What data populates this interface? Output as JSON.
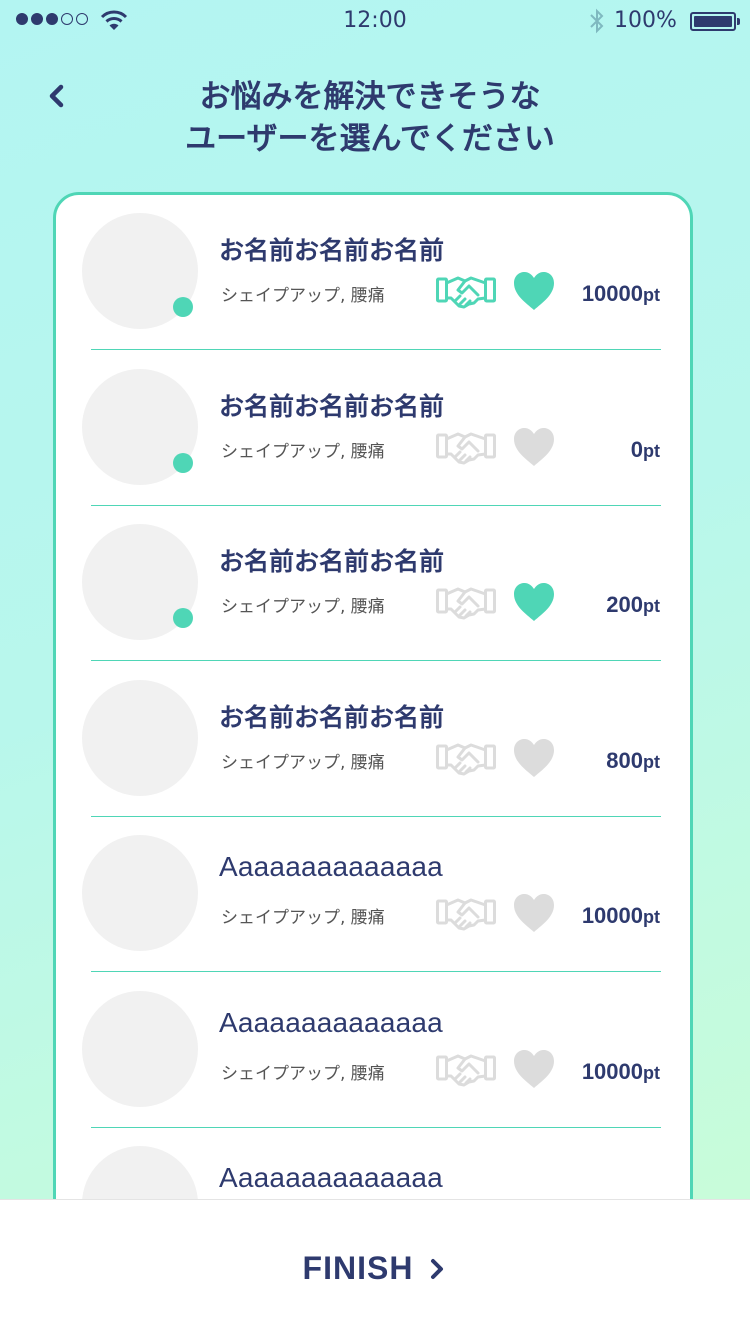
{
  "status_bar": {
    "time": "12:00",
    "battery": "100%",
    "signal_dots": [
      true,
      true,
      true,
      false,
      false
    ]
  },
  "header": {
    "title": "お悩みを解決できそうな\nユーザーを選んでください"
  },
  "colors": {
    "accent": "#4fd6b6",
    "text": "#2e3a6e",
    "inactive_icon": "#dcdcdc",
    "avatar": "#f1f1f1"
  },
  "users": [
    {
      "name": "お名前お名前お名前",
      "tags": "シェイプアップ, 腰痛",
      "points": "10000",
      "unit": "pt",
      "online": true,
      "handshake_active": true,
      "heart_active": true
    },
    {
      "name": "お名前お名前お名前",
      "tags": "シェイプアップ, 腰痛",
      "points": "0",
      "unit": "pt",
      "online": true,
      "handshake_active": false,
      "heart_active": false
    },
    {
      "name": "お名前お名前お名前",
      "tags": "シェイプアップ, 腰痛",
      "points": "200",
      "unit": "pt",
      "online": true,
      "handshake_active": false,
      "heart_active": true
    },
    {
      "name": "お名前お名前お名前",
      "tags": "シェイプアップ, 腰痛",
      "points": "800",
      "unit": "pt",
      "online": false,
      "handshake_active": false,
      "heart_active": false
    },
    {
      "name": "Aaaaaaaaaaaaaa",
      "tags": "シェイプアップ, 腰痛",
      "points": "10000",
      "unit": "pt",
      "online": false,
      "handshake_active": false,
      "heart_active": false
    },
    {
      "name": "Aaaaaaaaaaaaaa",
      "tags": "シェイプアップ, 腰痛",
      "points": "10000",
      "unit": "pt",
      "online": false,
      "handshake_active": false,
      "heart_active": false
    },
    {
      "name": "Aaaaaaaaaaaaaa",
      "tags": "",
      "points": "",
      "unit": "",
      "online": false,
      "handshake_active": false,
      "heart_active": false
    }
  ],
  "footer": {
    "finish_label": "FINISH"
  }
}
